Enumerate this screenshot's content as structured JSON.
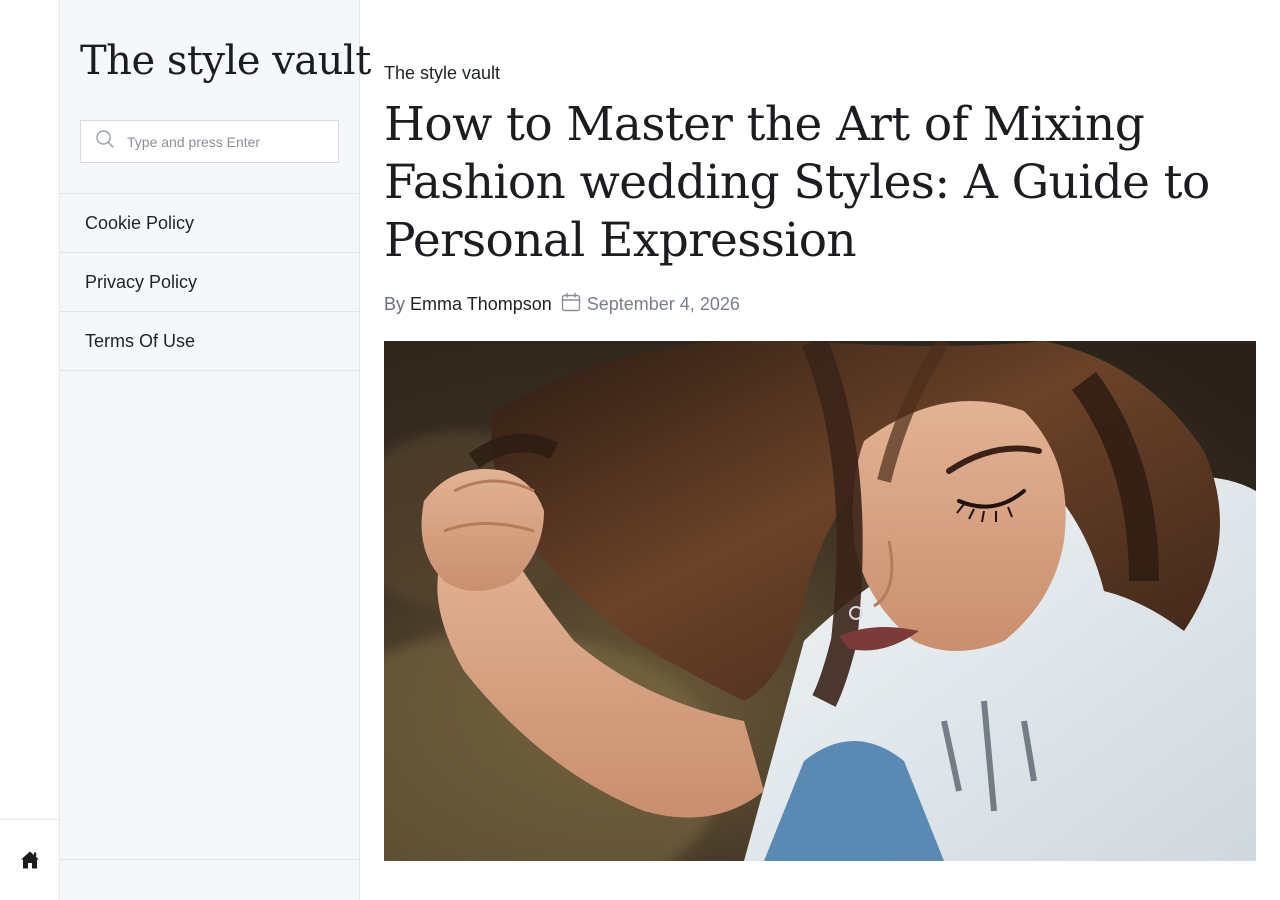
{
  "site": {
    "title": "The style vault"
  },
  "search": {
    "placeholder": "Type and press Enter"
  },
  "nav": {
    "items": [
      {
        "label": "Cookie Policy"
      },
      {
        "label": "Privacy Policy"
      },
      {
        "label": "Terms Of Use"
      }
    ]
  },
  "rail": {
    "icon": "home-icon"
  },
  "post": {
    "breadcrumb": "The style vault",
    "title": "How to Master the Art of Mixing Fashion wedding Styles: A Guide to Personal Expression",
    "by_label": "By",
    "author": "Emma Thompson",
    "date": "September 4, 2026",
    "date_icon": "calendar-icon",
    "image_subject": "woman-looking-down"
  }
}
